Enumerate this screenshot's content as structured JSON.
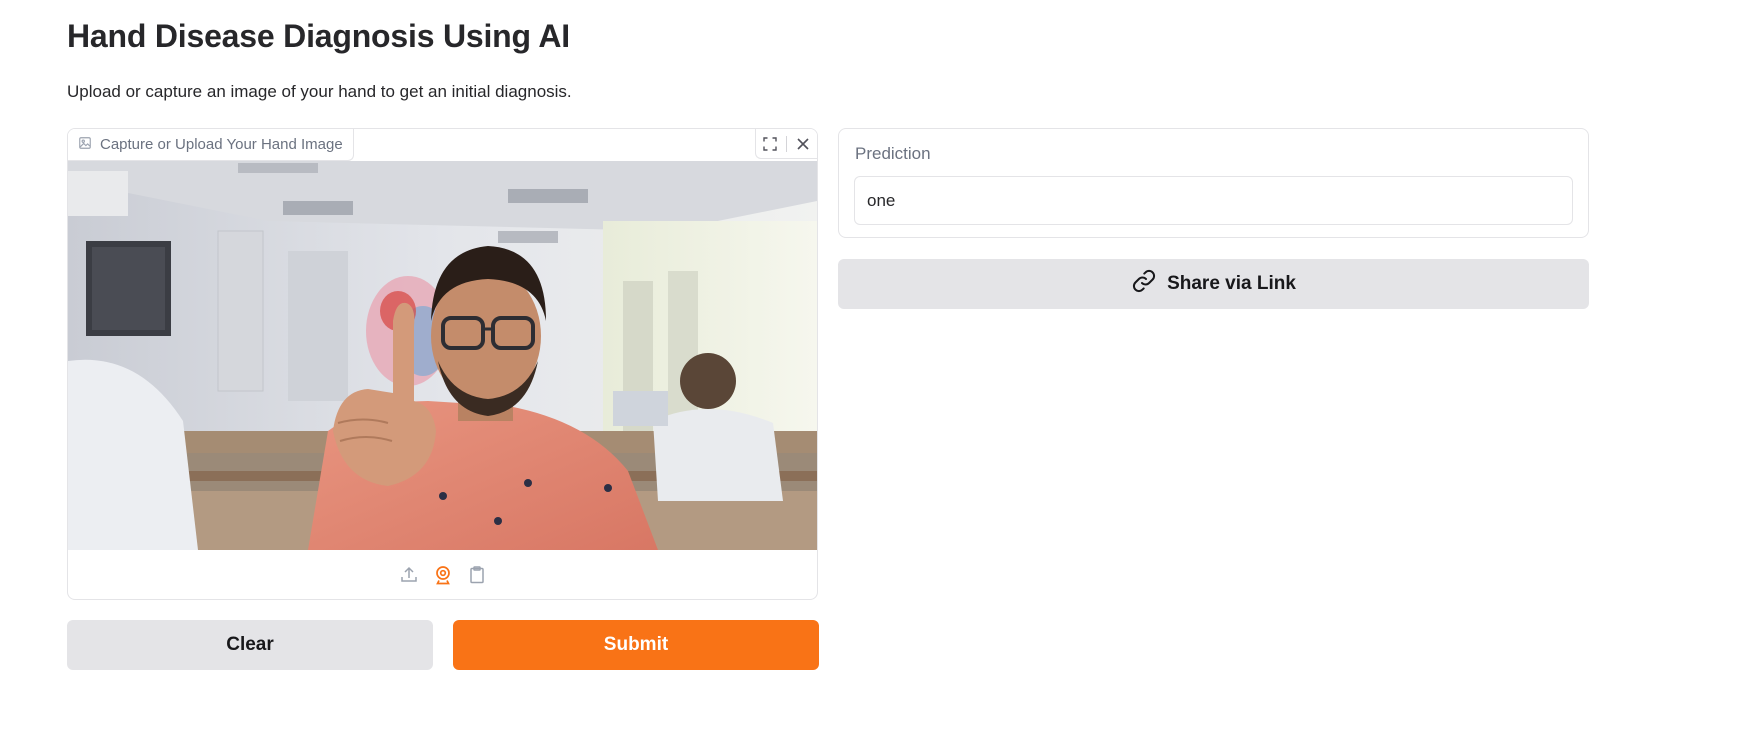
{
  "header": {
    "title": "Hand Disease Diagnosis Using AI",
    "description": "Upload or capture an image of your hand to get an initial diagnosis."
  },
  "image_input": {
    "label": "Capture or Upload Your Hand Image",
    "label_icon": "image-icon",
    "controls": [
      "fullscreen-icon",
      "close-icon"
    ],
    "sources": [
      "upload-icon",
      "webcam-icon",
      "clipboard-icon"
    ],
    "active_source": "webcam"
  },
  "actions": {
    "clear_label": "Clear",
    "submit_label": "Submit"
  },
  "prediction": {
    "label": "Prediction",
    "value": "one"
  },
  "share": {
    "label": "Share via Link",
    "icon": "link-icon"
  },
  "colors": {
    "accent": "#f97316",
    "secondary_button": "#e4e4e7",
    "border": "#e4e4e7",
    "muted_text": "#6b7280"
  }
}
